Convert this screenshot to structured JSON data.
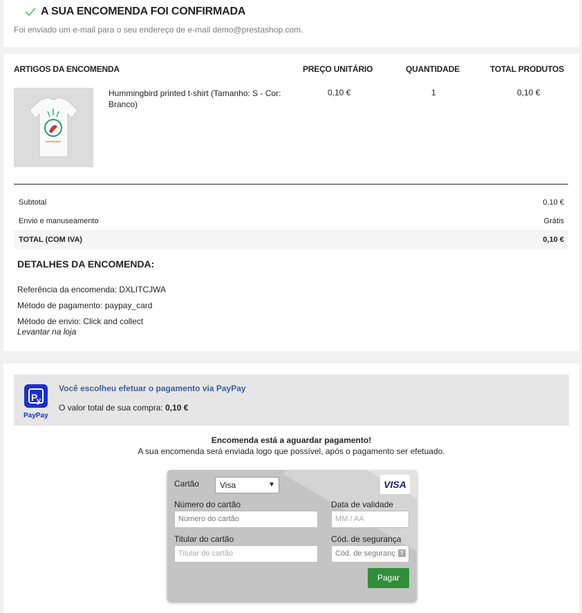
{
  "confirmation": {
    "title": "A SUA ENCOMENDA FOI CONFIRMADA",
    "subtitle": "Foi enviado um e-mail para o seu endereço de e-mail demo@prestashop.com."
  },
  "order_table": {
    "headers": [
      "ARTIGOS DA ENCOMENDA",
      "PREÇO UNITÁRIO",
      "QUANTIDADE",
      "TOTAL PRODUTOS"
    ],
    "items": [
      {
        "name": "Hummingbird printed t-shirt (Tamanho: S - Cor: Branco)",
        "unit_price": "0,10 €",
        "quantity": "1",
        "total": "0,10 €"
      }
    ]
  },
  "summary": {
    "subtotal_label": "Subtotal",
    "subtotal_value": "0,10 €",
    "shipping_label": "Envio e manuseamento",
    "shipping_value": "Grátis",
    "total_label": "TOTAL (COM IVA)",
    "total_value": "0,10 €"
  },
  "details": {
    "title": "DETALHES DA ENCOMENDA:",
    "reference": "Referência da encomenda: DXLITCJWA",
    "payment_method": "Método de pagamento: paypay_card",
    "shipping_method": "Método de envio: Click and collect",
    "shipping_note": "Levantar na loja"
  },
  "paypay": {
    "logo_text": "PayPay",
    "title": "Você escolheu efetuar o pagamento via PayPay",
    "total_prefix": "O valor total de sua compra:",
    "total_value": "0,10 €",
    "awaiting_title": "Encomenda está a aguardar pagamento!",
    "awaiting_text": "A sua encomenda será enviada logo que possível, após o pagamento ser efetuado."
  },
  "card_form": {
    "card_label": "Cartão",
    "card_selected": "Visa",
    "brand": "VISA",
    "number_label": "Número do cartão",
    "number_placeholder": "Número do cartão",
    "expiry_label": "Data de validade",
    "expiry_placeholder": "MM / AA",
    "holder_label": "Titular do cartão",
    "holder_placeholder": "Titular do cartão",
    "cvv_label": "Cód. de segurança",
    "cvv_placeholder": "Cód. de seguranç",
    "help": "?",
    "pay_button": "Pagar"
  },
  "colors": {
    "accent_green": "#2f8f3a",
    "paypay_blue": "#1a2fd6",
    "link_blue": "#3b5f9a"
  },
  "icons": [
    "check-icon",
    "tshirt-image",
    "paypay-logo-icon",
    "visa-icon",
    "help-icon",
    "chevron-down-icon"
  ]
}
